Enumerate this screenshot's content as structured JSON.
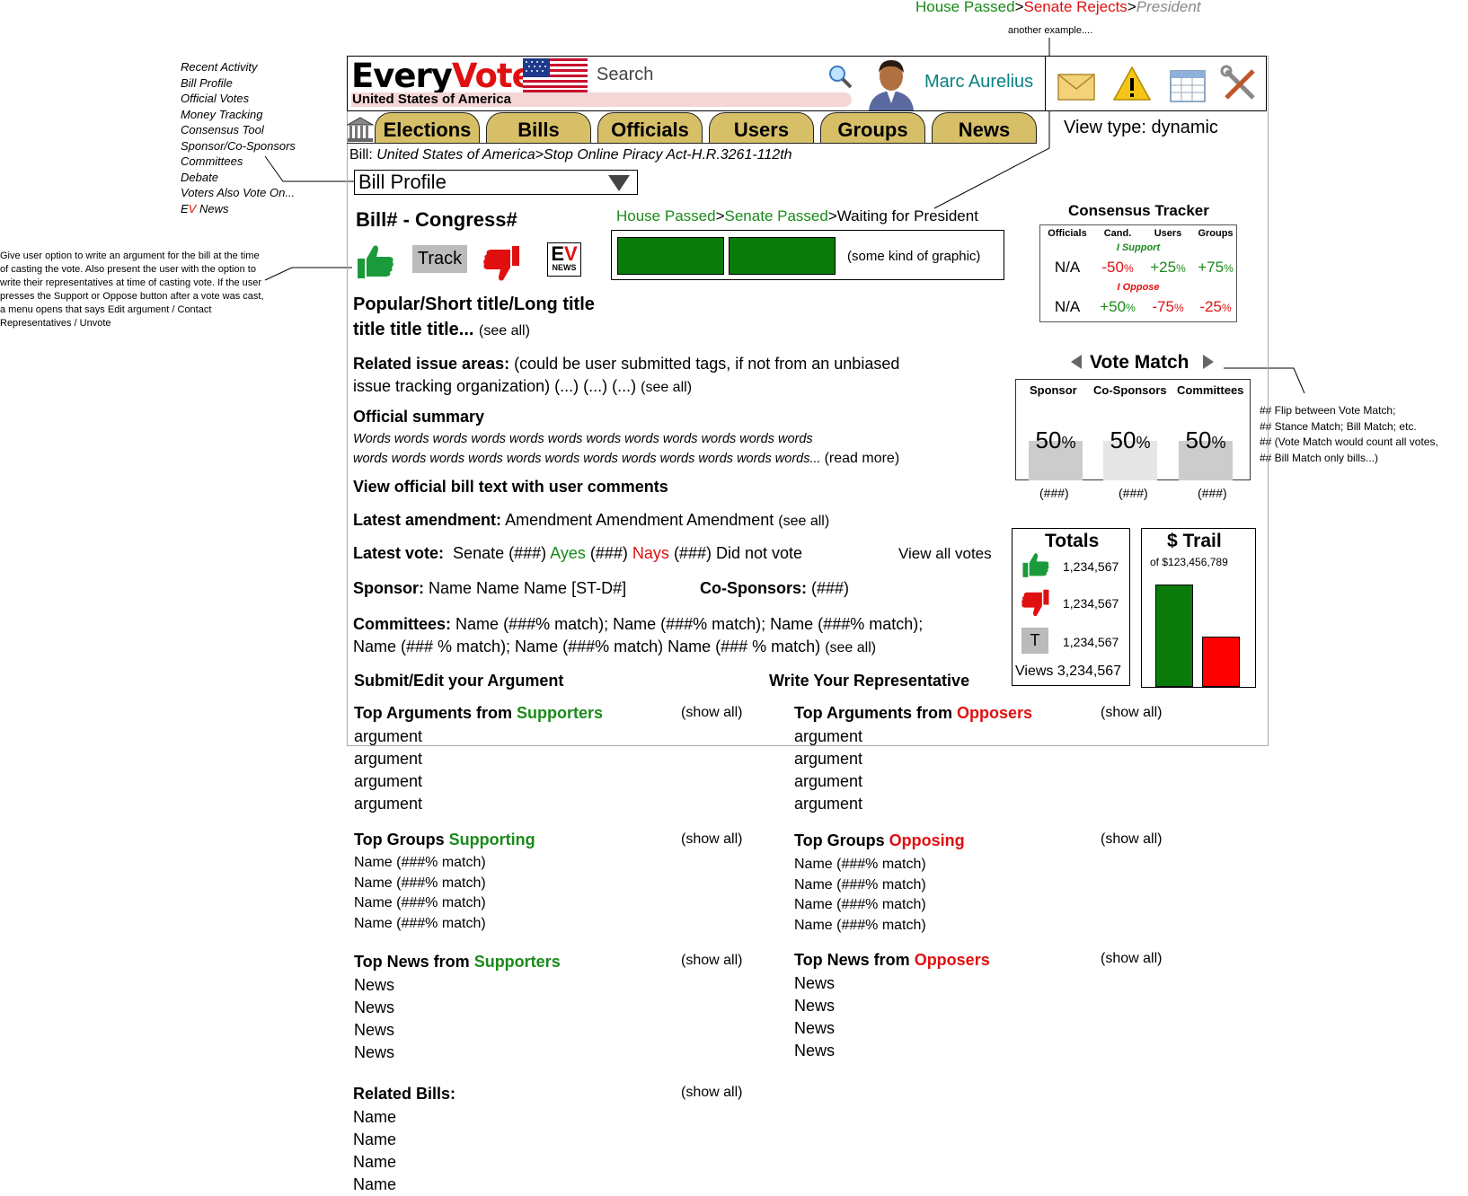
{
  "annotations": {
    "top_example": {
      "house": "House Passed",
      "sep1": ">",
      "senate": "Senate Rejects",
      "sep2": ">",
      "president": "President"
    },
    "another_example": "another example....",
    "sidenav": [
      "Recent Activity",
      "Bill Profile",
      "Official Votes",
      "Money Tracking",
      "Consensus Tool",
      "Sponsor/Co-Sponsors",
      "Committees",
      "Debate",
      "Voters Also Vote On..."
    ],
    "sidenav_ev_news": {
      "e": "E",
      "v": "V",
      "rest": " News"
    },
    "left_note": "Give user option to write an argument for the bill at the time of casting the vote. Also present the user with the option to write their representatives at time of casting vote. If the user presses the Support or Oppose button after a vote was cast, a menu opens that says  Edit argument / Contact Representatives / Unvote",
    "right_note": [
      "## Flip between Vote Match;",
      "## Stance Match; Bill Match; etc.",
      "## (Vote Match would count all votes,",
      "## Bill Match only bills...)"
    ]
  },
  "header": {
    "logo_every": "Every",
    "logo_vote": "Vote",
    "country": "United States of America",
    "search_placeholder": "Search",
    "user_name": "Marc Aurelius"
  },
  "tabs": [
    "Elections",
    "Bills",
    "Officials",
    "Users",
    "Groups",
    "News"
  ],
  "view_type": "View type: dynamic",
  "breadcrumb": {
    "prefix": "Bill: ",
    "path": "United States of America>Stop Online Piracy Act-H.R.3261-112th"
  },
  "selector": {
    "value": "Bill Profile"
  },
  "bill": {
    "title": "Bill# - Congress#",
    "track_label": "Track",
    "ev_news": {
      "e": "E",
      "v": "V",
      "news": "NEWS"
    },
    "status": {
      "house": "House Passed",
      "sep1": ">",
      "senate": "Senate Passed",
      "sep2": ">",
      "waiting": "Waiting for President"
    },
    "graphic_label": "(some kind of graphic)",
    "short_title_1": "Popular/Short title/Long title",
    "short_title_2": "title title title...",
    "see_all": "(see all)",
    "issues_label": "Related issue areas:",
    "issues_text": "(could be user submitted tags, if not from an unbiased",
    "issues_text2": "issue tracking organization) (...) (...) (...)",
    "summary_label": "Official summary",
    "summary_line1": "Words words words words words words words words words words words words",
    "summary_line2": "words words words words words words words words words words words words...",
    "read_more": "(read more)",
    "view_text": "View official bill text with user comments",
    "amend_label": "Latest amendment:",
    "amend_text": "Amendment Amendment Amendment",
    "vote_label": "Latest vote:",
    "vote_senate": "Senate (###)",
    "vote_ayes": "Ayes",
    "vote_mid": "(###)",
    "vote_nays": "Nays",
    "vote_end": "(###) Did not vote",
    "view_all_votes": "View all votes",
    "sponsor_label": "Sponsor:",
    "sponsor_text": "Name Name Name [ST-D#]",
    "cosponsor_label": "Co-Sponsors:",
    "cosponsor_text": "(###)",
    "committees_label": "Committees:",
    "committees_line1": "Name (###% match); Name (###% match); Name (###% match);",
    "committees_line2": "Name (### % match); Name (###% match) Name (### % match)",
    "submit_arg": "Submit/Edit your Argument",
    "write_rep": "Write Your Representative"
  },
  "consensus": {
    "title": "Consensus Tracker",
    "headers": [
      "Officials",
      "Cand.",
      "Users",
      "Groups"
    ],
    "support_label": "I Support",
    "oppose_label": "I Oppose",
    "support_row": {
      "officials": "N/A",
      "cand": "-50",
      "users": "+25",
      "groups": "+75"
    },
    "oppose_row": {
      "officials": "N/A",
      "cand": "+50",
      "users": "-75",
      "groups": "-25"
    },
    "pct": "%"
  },
  "vote_match": {
    "title": "Vote Match",
    "columns": [
      {
        "label": "Sponsor",
        "value": "50",
        "count": "(###)"
      },
      {
        "label": "Co-Sponsors",
        "value": "50",
        "count": "(###)"
      },
      {
        "label": "Committees",
        "value": "50",
        "count": "(###)"
      }
    ],
    "pct": "%"
  },
  "totals": {
    "title": "Totals",
    "support": "1,234,567",
    "oppose": "1,234,567",
    "track_letter": "T",
    "track": "1,234,567",
    "views": "Views 3,234,567"
  },
  "trail": {
    "title": "$ Trail",
    "subtitle": "of $123,456,789"
  },
  "lists": {
    "show_all": "(show all)",
    "args_sup_prefix": "Top Arguments from ",
    "args_sup_word": "Supporters",
    "args_opp_prefix": "Top Arguments from ",
    "args_opp_word": "Opposers",
    "arguments_left": [
      "argument",
      "argument",
      "argument",
      "argument"
    ],
    "arguments_right": [
      "argument",
      "argument",
      "argument",
      "argument"
    ],
    "groups_sup_prefix": "Top Groups ",
    "groups_sup_word": "Supporting",
    "groups_opp_prefix": "Top Groups ",
    "groups_opp_word": "Opposing",
    "groups_left": [
      "Name (###% match)",
      "Name (###% match)",
      "Name (###% match)",
      "Name (###% match)"
    ],
    "groups_right": [
      "Name (###% match)",
      "Name (###% match)",
      "Name (###% match)",
      "Name (###% match)"
    ],
    "news_sup_prefix": "Top News from ",
    "news_sup_word": "Supporters",
    "news_opp_prefix": "Top News from ",
    "news_opp_word": "Opposers",
    "news_left": [
      "News",
      "News",
      "News",
      "News"
    ],
    "news_right": [
      "News",
      "News",
      "News",
      "News"
    ],
    "related_label": "Related Bills:",
    "related": [
      "Name",
      "Name",
      "Name",
      "Name"
    ]
  },
  "colors": {
    "support_green": "#1a8a1a",
    "oppose_red": "#e01010",
    "tab_gold": "#d7bf68",
    "user_teal": "#0a8080"
  }
}
